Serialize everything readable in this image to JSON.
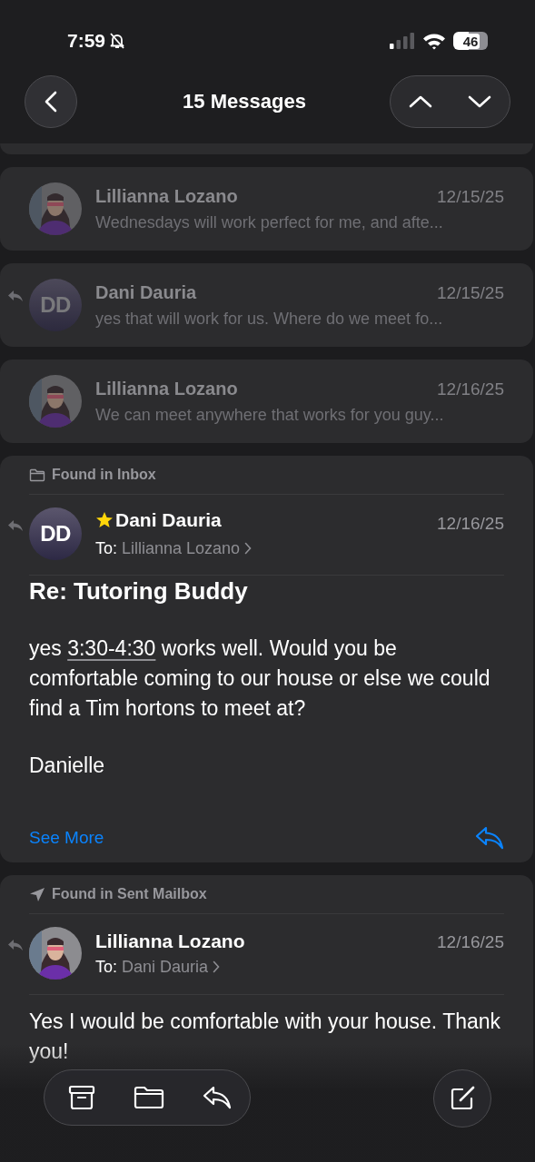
{
  "status_bar": {
    "time": "7:59",
    "silenced": true,
    "battery": "46"
  },
  "nav": {
    "title": "15 Messages"
  },
  "messages": [
    {
      "kind": "hidden"
    },
    {
      "kind": "collapsed",
      "sender": "Lillianna Lozano",
      "avatar": {
        "kind": "picture"
      },
      "date": "12/15/25",
      "preview": "Wednesdays will work perfect for me, and afte...",
      "replied": false,
      "starred": false
    },
    {
      "kind": "collapsed",
      "sender": "Dani Dauria",
      "avatar": {
        "kind": "initials",
        "initials": "DD"
      },
      "date": "12/15/25",
      "preview": "yes that will work for us. Where do we meet fo...",
      "replied": true,
      "starred": false
    },
    {
      "kind": "collapsed",
      "sender": "Lillianna Lozano",
      "avatar": {
        "kind": "picture"
      },
      "date": "12/16/25",
      "preview": "We can meet anywhere that works for you guy...",
      "replied": false,
      "starred": false
    },
    {
      "kind": "expanded",
      "found_in": {
        "label": "Found in Inbox"
      },
      "sender": "Dani Dauria",
      "avatar": {
        "kind": "initials",
        "initials": "DD"
      },
      "date": "12/16/25",
      "to_label": "To:",
      "to": "Lillianna Lozano",
      "replied": true,
      "starred": true,
      "subject": "Re: Tutoring Buddy",
      "paragraphs": [
        [
          {
            "text": "yes "
          },
          {
            "text": "3:30-4:30",
            "link": true
          },
          {
            "text": " works well. Would you be comfortable coming to our house or else we could find a Tim hortons to meet at?"
          }
        ],
        [
          {
            "text": "Danielle"
          }
        ]
      ],
      "see_more": "See More"
    },
    {
      "kind": "expanded",
      "found_in": {
        "label": "Found in Sent Mailbox"
      },
      "sender": "Lillianna Lozano",
      "avatar": {
        "kind": "picture"
      },
      "date": "12/16/25",
      "to_label": "To:",
      "to": "Dani Dauria",
      "replied": true,
      "starred": false,
      "paragraphs": [
        [
          {
            "text": "Yes I would be comfortable with your house. Thank you!"
          }
        ]
      ]
    }
  ]
}
